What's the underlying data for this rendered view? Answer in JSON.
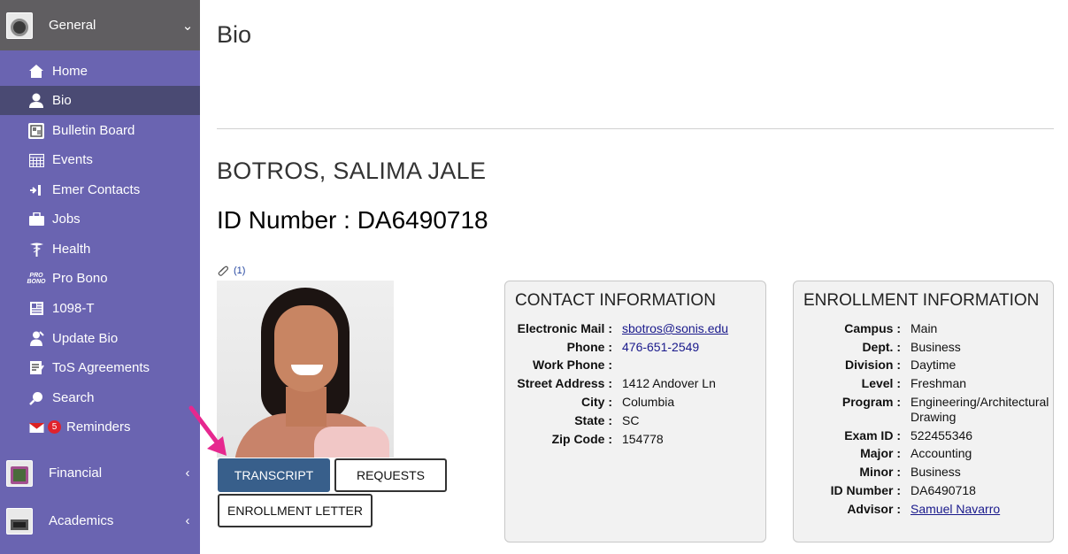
{
  "sidebar": {
    "sections": [
      {
        "label": "General",
        "arrow": "⌄",
        "expanded": true
      },
      {
        "label": "Financial",
        "arrow": "‹",
        "expanded": false
      },
      {
        "label": "Academics",
        "arrow": "‹",
        "expanded": false
      }
    ],
    "items": [
      {
        "label": "Home",
        "icon": "home-icon"
      },
      {
        "label": "Bio",
        "icon": "person-icon",
        "active": true
      },
      {
        "label": "Bulletin Board",
        "icon": "bulletin-board-icon"
      },
      {
        "label": "Events",
        "icon": "calendar-icon"
      },
      {
        "label": "Emer Contacts",
        "icon": "emergency-contact-icon"
      },
      {
        "label": "Jobs",
        "icon": "briefcase-icon"
      },
      {
        "label": "Health",
        "icon": "caduceus-icon"
      },
      {
        "label": "Pro Bono",
        "icon": "pro-bono-icon",
        "icon_text_1": "PRO",
        "icon_text_2": "BONO"
      },
      {
        "label": "1098-T",
        "icon": "tax-form-icon"
      },
      {
        "label": "Update Bio",
        "icon": "update-bio-icon"
      },
      {
        "label": "ToS Agreements",
        "icon": "agreement-icon"
      },
      {
        "label": "Search",
        "icon": "search-icon"
      },
      {
        "label": "Reminders",
        "icon": "reminder-icon",
        "badge": "5"
      }
    ]
  },
  "main": {
    "page_title": "Bio",
    "student_name": "BOTROS, SALIMA JALE",
    "id_number_heading": "ID Number : DA6490718",
    "attachment_count": "(1)",
    "buttons": {
      "transcript": "TRANSCRIPT",
      "requests": "REQUESTS",
      "enrollment_letter": "ENROLLMENT LETTER"
    },
    "contact": {
      "title": "CONTACT INFORMATION",
      "rows": [
        {
          "label": "Electronic Mail :",
          "value": "sbotros@sonis.edu",
          "kind": "link"
        },
        {
          "label": "Phone :",
          "value": "476-651-2549",
          "kind": "phone"
        },
        {
          "label": "Work Phone :",
          "value": ""
        },
        {
          "label": "Street Address :",
          "value": "1412 Andover Ln"
        },
        {
          "label": "City :",
          "value": "Columbia"
        },
        {
          "label": "State :",
          "value": "SC"
        },
        {
          "label": "Zip Code :",
          "value": "154778"
        }
      ]
    },
    "enrollment": {
      "title": "ENROLLMENT INFORMATION",
      "rows": [
        {
          "label": "Campus :",
          "value": "Main"
        },
        {
          "label": "Dept. :",
          "value": "Business"
        },
        {
          "label": "Division :",
          "value": "Daytime"
        },
        {
          "label": "Level :",
          "value": "Freshman"
        },
        {
          "label": "Program :",
          "value": "Engineering/Architectural Drawing"
        },
        {
          "label": "Exam ID :",
          "value": "522455346"
        },
        {
          "label": "Major :",
          "value": "Accounting"
        },
        {
          "label": "Minor :",
          "value": "Business"
        },
        {
          "label": "ID Number :",
          "value": "DA6490718"
        },
        {
          "label": "Advisor :",
          "value": "Samuel Navarro",
          "kind": "link"
        }
      ]
    }
  },
  "colors": {
    "sidebar_bg": "#6a64b1",
    "section_header_bg": "#605e61",
    "active_item_bg": "#4a4a73",
    "primary_button": "#385f8b",
    "arrow_annotation": "#e6288f",
    "badge": "#e0222d"
  }
}
